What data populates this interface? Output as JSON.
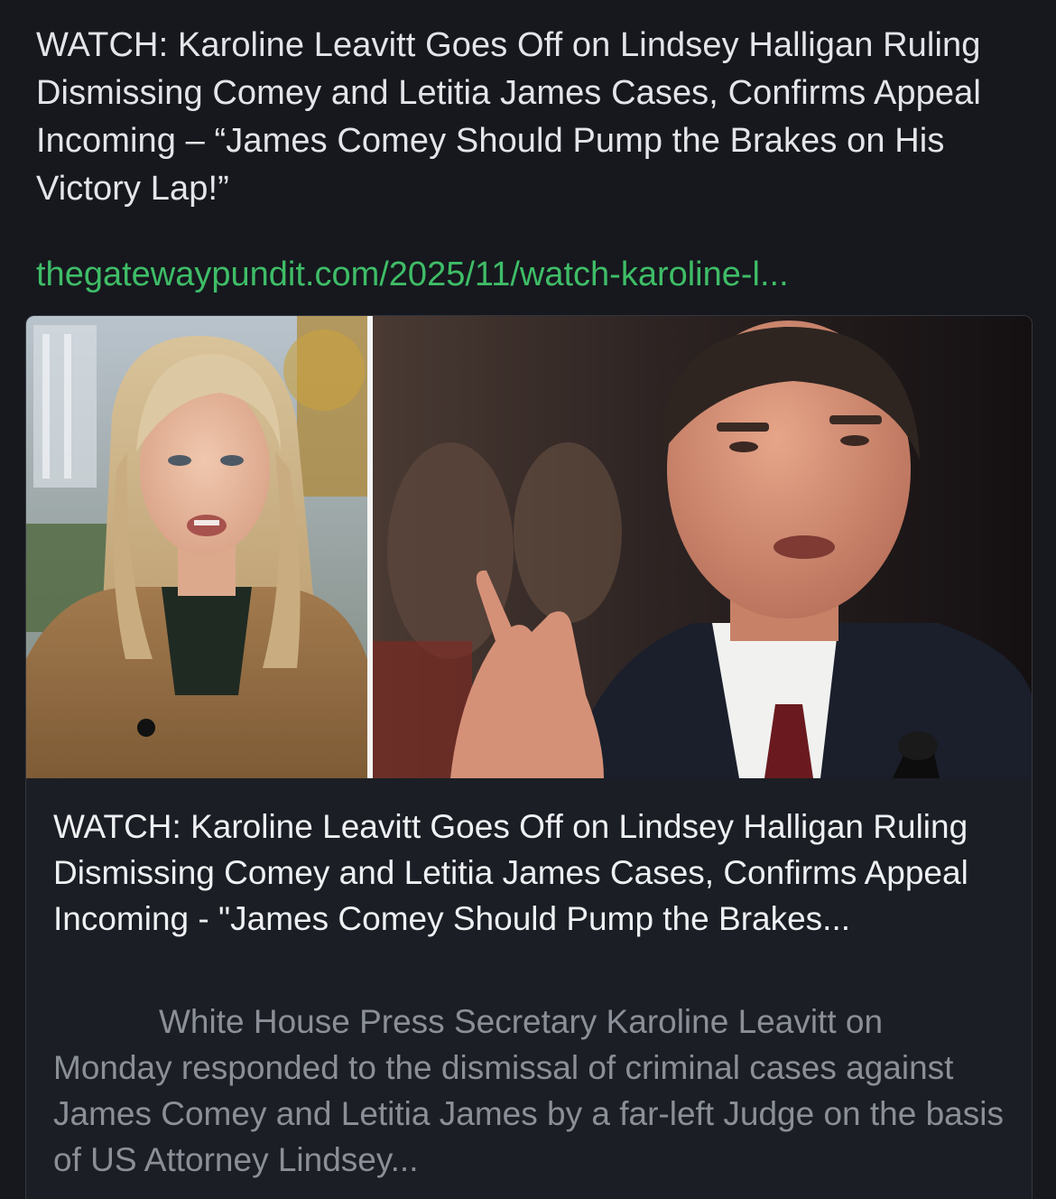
{
  "post": {
    "text": "WATCH: Karoline Leavitt Goes Off on Lindsey Halligan Ruling Dismissing Comey and Letitia James Cases, Confirms Appeal Incoming – “James Comey Should Pump the Brakes on His Victory Lap!”",
    "link_text": "thegatewaypundit.com/2025/11/watch-karoline-l..."
  },
  "card": {
    "image_icon": "news-photo-image",
    "title": "WATCH: Karoline Leavitt Goes Off on Lindsey Halligan Ruling Dismissing Comey and Letitia James Cases, Confirms Appeal Incoming - \"James Comey Should Pump the Brakes...",
    "description": "White House Press Secretary Karoline Leavitt on Monday responded to the dismissal of criminal cases against James Comey and Letitia James by a far-left Judge on the basis of US Attorney Lindsey..."
  },
  "colors": {
    "background": "#16181e",
    "link": "#3fbd67",
    "card_border": "#34373e",
    "description": "#8b8f97"
  }
}
